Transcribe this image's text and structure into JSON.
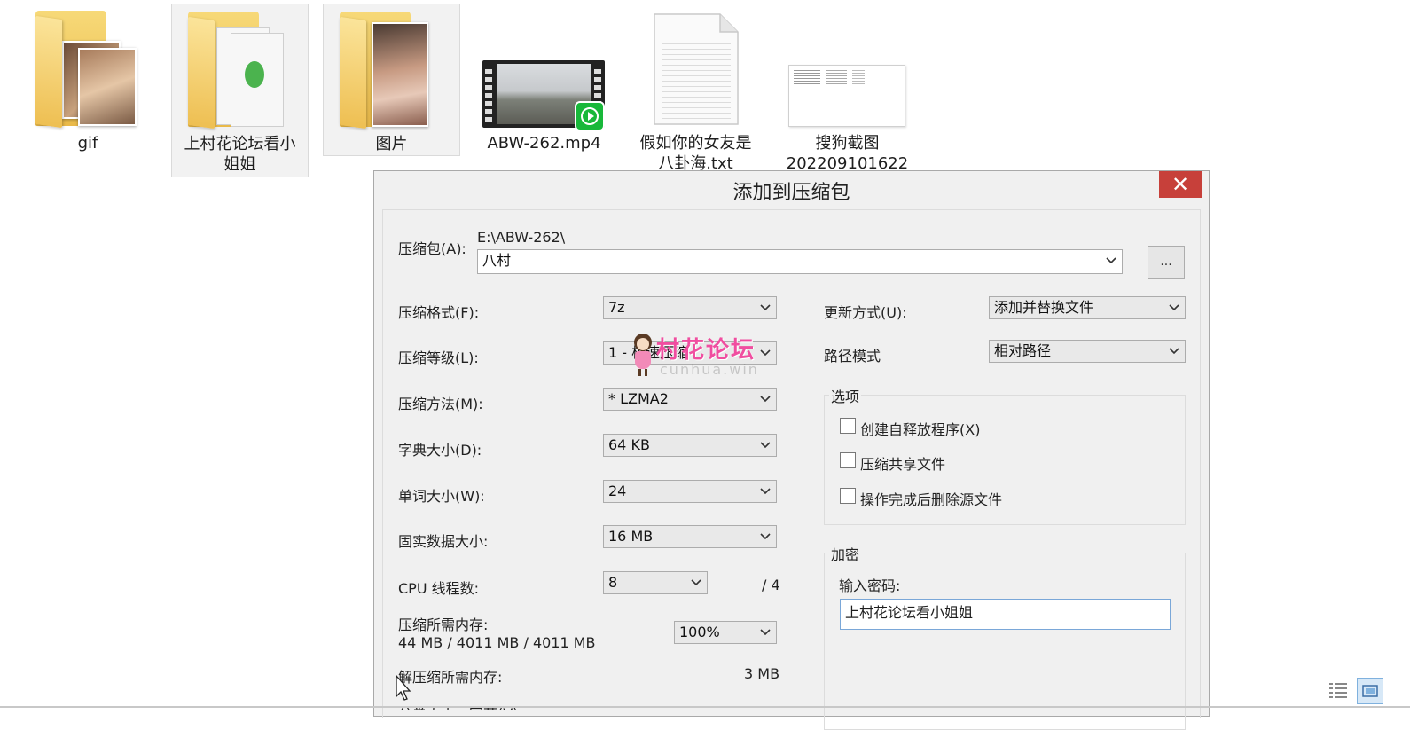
{
  "files": [
    {
      "name": "gif",
      "icon": "folder-with-photos-icon"
    },
    {
      "name": "上村花论坛看小\n姐姐",
      "icon": "folder-with-documents-icon"
    },
    {
      "name": "图片",
      "icon": "folder-with-photos-icon"
    },
    {
      "name": "ABW-262.mp4",
      "icon": "video-thumbnail-icon"
    },
    {
      "name": "假如你的女友是\n八卦海.txt",
      "icon": "text-document-icon"
    },
    {
      "name": "搜狗截图\n202209101622",
      "icon": "screenshot-thumbnail-icon"
    }
  ],
  "dialog": {
    "title": "添加到压缩包",
    "close_symbol": "✕",
    "archive_label": "压缩包(A):",
    "archive_path": "E:\\ABW-262\\",
    "archive_name": "八村",
    "browse_label": "...",
    "format_label": "压缩格式(F):",
    "format_value": "7z",
    "level_label": "压缩等级(L):",
    "level_value": "1 - 极速压缩",
    "method_label": "压缩方法(M):",
    "method_value": "* LZMA2",
    "dict_label": "字典大小(D):",
    "dict_value": "64 KB",
    "word_label": "单词大小(W):",
    "word_value": "24",
    "solid_label": "固实数据大小:",
    "solid_value": "16 MB",
    "cpu_label": "CPU 线程数:",
    "cpu_value": "8",
    "cpu_total": "/ 4",
    "mem_label": "压缩所需内存:",
    "mem_value": "44 MB / 4011 MB / 4011 MB",
    "mem_percent": "100%",
    "decomp_label": "解压缩所需内存:",
    "decomp_value": "3 MB",
    "split_label": "分卷大小，字节(V):",
    "update_label": "更新方式(U):",
    "update_value": "添加并替换文件",
    "path_label": "路径模式",
    "path_value": "相对路径",
    "options_title": "选项",
    "options": [
      {
        "label": "创建自释放程序(X)",
        "checked": false
      },
      {
        "label": "压缩共享文件",
        "checked": false
      },
      {
        "label": "操作完成后删除源文件",
        "checked": false
      }
    ],
    "encrypt_title": "加密",
    "password_label": "输入密码:",
    "password_value": "上村花论坛看小姐姐"
  },
  "watermark": {
    "text": "村花论坛",
    "sub": "cunhua.win"
  },
  "colors": {
    "close": "#c7403a",
    "watermark": "#f04ea0",
    "folder": "#f3cf66"
  }
}
